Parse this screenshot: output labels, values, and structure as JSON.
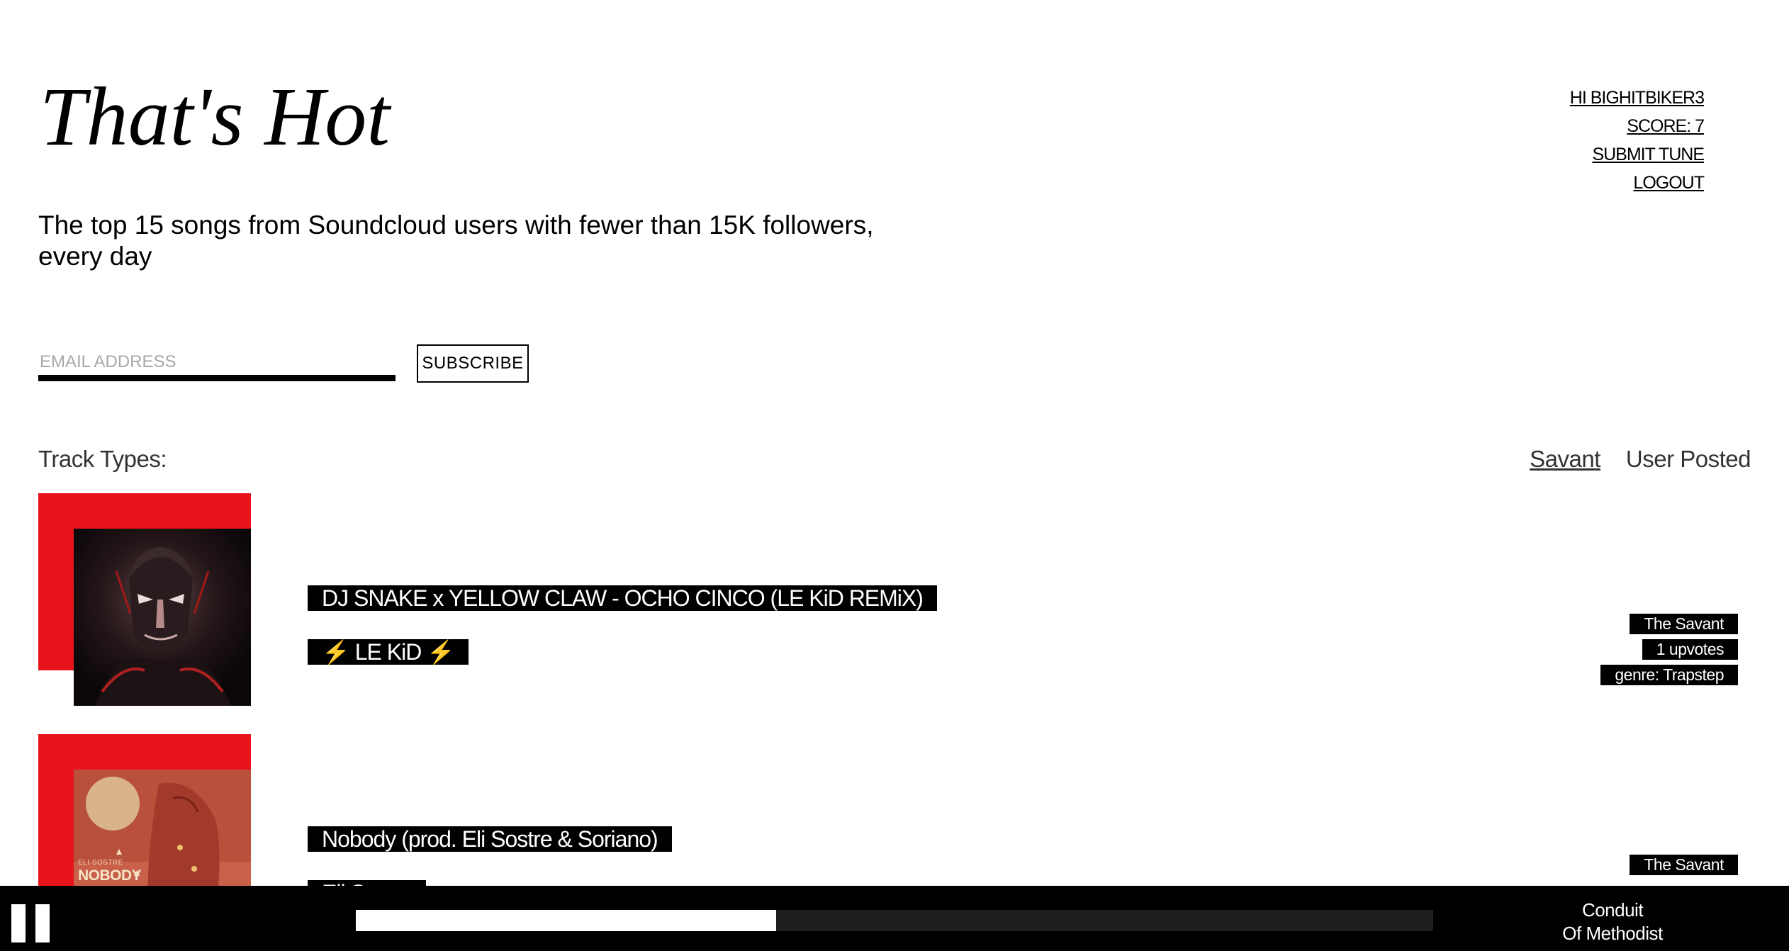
{
  "site": {
    "title": "That's Hot",
    "tagline": "The top 15 songs from Soundcloud users with fewer than 15K followers, every day"
  },
  "user_nav": {
    "greeting": "HI BIGHITBIKER3",
    "score": "SCORE: 7",
    "submit": "SUBMIT TUNE",
    "logout": "LOGOUT"
  },
  "subscribe": {
    "placeholder": "EMAIL ADDRESS",
    "button_label": "SUBSCRIBE"
  },
  "filters": {
    "label": "Track Types:",
    "options": [
      "Savant",
      "User Posted"
    ],
    "active": "Savant"
  },
  "tracks": [
    {
      "title": "DJ SNAKE x YELLOW CLAW - OCHO CINCO (LE KiD REMiX)",
      "artist": "⚡ LE KiD ⚡",
      "source": "The Savant",
      "upvotes": "1 upvotes",
      "genre": "genre: Trapstep"
    },
    {
      "title": "Nobody (prod. Eli Sostre & Soriano)",
      "artist": "Eli Sostre",
      "source": "The Savant",
      "upvotes": "",
      "genre": "",
      "art_text_top": "ELI SOSTRE",
      "art_text_bottom": "NOBODY"
    }
  ],
  "player": {
    "now_playing_line1": "Conduit",
    "now_playing_line2": "Of Methodist",
    "progress": 0.39
  },
  "colors": {
    "accent_red": "#e8141c",
    "player_bg": "#000000",
    "tag_bg": "#000000"
  },
  "icons": {
    "player_control": "pause-icon"
  }
}
